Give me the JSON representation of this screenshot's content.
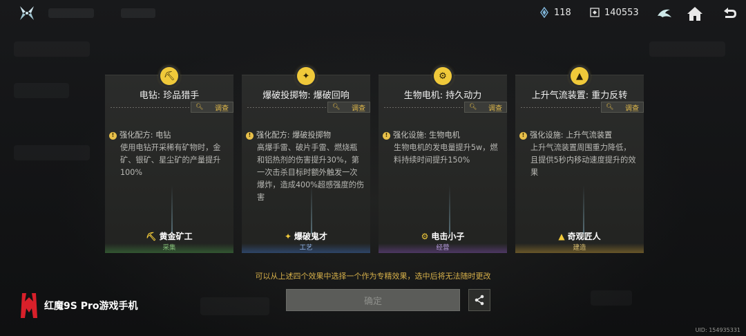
{
  "resources": {
    "energy": "118",
    "credits": "140553"
  },
  "cards": [
    {
      "title": "电钻: 珍品猎手",
      "investigate": "调查",
      "head": "强化配方: 电钻",
      "desc": "使用电钻开采稀有矿物时，金矿、银矿、星尘矿的产量提升100%",
      "badge": "黄金矿工",
      "category": "采集",
      "color": "#86c07a"
    },
    {
      "title": "爆破投掷物: 爆破回响",
      "investigate": "调查",
      "head": "强化配方: 爆破投掷物",
      "desc": "高爆手雷、破片手雷、燃烧瓶和铝热剂的伤害提升30%，第一次击杀目标时额外触发一次爆炸，造成400%超感强度的伤害",
      "badge": "爆破鬼才",
      "category": "工艺",
      "color": "#8fb0e0"
    },
    {
      "title": "生物电机: 持久动力",
      "investigate": "调查",
      "head": "强化设施: 生物电机",
      "desc": "生物电机的发电量提升5w，燃料持续时间提升150%",
      "badge": "电击小子",
      "category": "经营",
      "color": "#b59cdb"
    },
    {
      "title": "上升气流装置: 重力反转",
      "investigate": "调查",
      "head": "强化设施: 上升气流装置",
      "desc": "上升气流装置周围重力降低，且提供5秒内移动速度提升的效果",
      "badge": "奇观匠人",
      "category": "建造",
      "color": "#d8bd70"
    }
  ],
  "hint": "可以从上述四个效果中选择一个作为专精效果，选中后将无法随时更改",
  "confirm_label": "确定",
  "brand": "红魔9S Pro游戏手机",
  "uid": "UID: 154935331",
  "icons": {
    "logo": "x-logo-icon",
    "energy": "crystal-icon",
    "credits": "currency-icon",
    "bird": "bird-icon",
    "home": "home-icon",
    "back": "back-arrow-icon",
    "share": "share-icon",
    "search": "magnifier-icon"
  }
}
